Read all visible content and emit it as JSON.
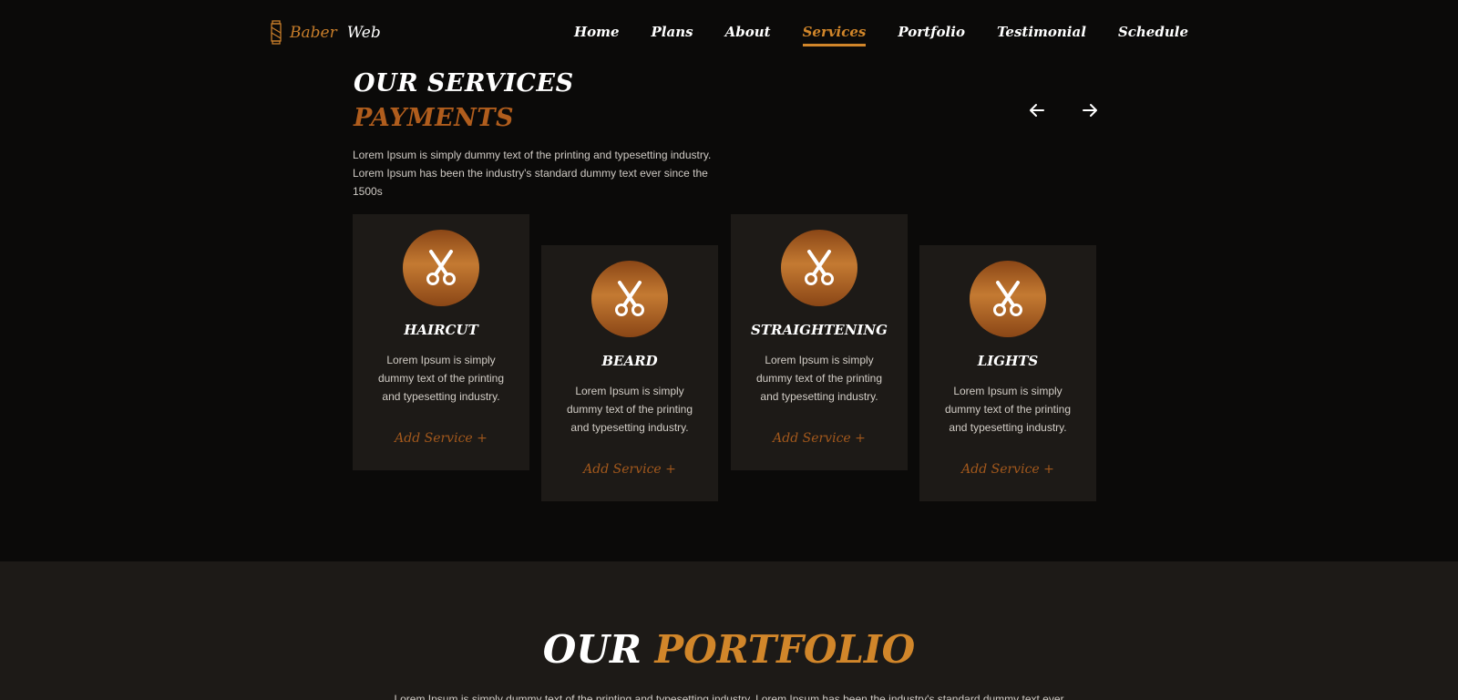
{
  "brand": {
    "first": "Baber",
    "second": "Web",
    "accent": "#c77d2a"
  },
  "nav": {
    "items": [
      {
        "label": "Home"
      },
      {
        "label": "Plans"
      },
      {
        "label": "About"
      },
      {
        "label": "Services",
        "active": true
      },
      {
        "label": "Portfolio"
      },
      {
        "label": "Testimonial"
      },
      {
        "label": "Schedule"
      }
    ]
  },
  "services": {
    "title": "OUR SERVICES",
    "subtitle": "PAYMENTS",
    "intro": "Lorem Ipsum is simply dummy text of the printing and typesetting industry. Lorem Ipsum has been the industry's standard dummy text ever since the 1500s",
    "prev_icon": "arrow-left-icon",
    "next_icon": "arrow-right-icon",
    "cards": [
      {
        "title": "HAIRCUT",
        "icon": "scissors-icon",
        "desc": "Lorem Ipsum is simply dummy text of the printing and typesetting industry.",
        "link": "Add Service +"
      },
      {
        "title": "BEARD",
        "icon": "scissors-icon",
        "desc": "Lorem Ipsum is simply dummy text of the printing and typesetting industry.",
        "link": "Add Service +"
      },
      {
        "title": "STRAIGHTENING",
        "icon": "scissors-icon",
        "desc": "Lorem Ipsum is simply dummy text of the printing and typesetting industry.",
        "link": "Add Service +"
      },
      {
        "title": "LIGHTS",
        "icon": "scissors-icon",
        "desc": "Lorem Ipsum is simply dummy text of the printing and typesetting industry.",
        "link": "Add Service +"
      }
    ]
  },
  "portfolio": {
    "title_white": "OUR",
    "title_orange": "PORTFOLIO",
    "desc": "Lorem Ipsum is simply dummy text of the printing and typesetting industry. Lorem Ipsum has been the industry's standard dummy text ever"
  },
  "colors": {
    "background": "#0b0a09",
    "card": "#1d1a17",
    "accent": "#d1862a",
    "accent_dark": "#b05d1d"
  }
}
